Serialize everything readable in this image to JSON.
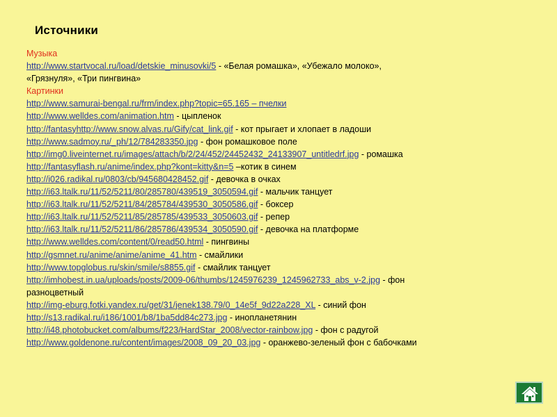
{
  "title": "Источники",
  "sections": {
    "music_label": "Музыка",
    "pictures_label": "Картинки"
  },
  "music": {
    "url": "http://www.startvocal.ru/load/detskie_minusovki/5",
    "desc_line1": " - «Белая ромашка», «Убежало молоко»,",
    "desc_line2": "«Грязнуля», «Три пингвина»"
  },
  "pictures": [
    {
      "url": "http://www.samurai-bengal.ru/frm/index.php?topic=65.165 – пчелки",
      "desc": ""
    },
    {
      "url": "http://www.welldes.com/animation.htm",
      "desc": " - цыпленок"
    },
    {
      "url": "http://fantasyhttp://www.snow.alvas.ru/Gify/cat_link.gif",
      "desc": " - кот прыгает и хлопает в ладоши"
    },
    {
      "url": "http://www.sadmoy.ru/_ph/12/784283350.jpg",
      "desc": " - фон ромашковое поле"
    },
    {
      "url": "http://img0.liveinternet.ru/images/attach/b/2/24/452/24452432_24133907_untitledrf.jpg",
      "desc": " - ромашка"
    },
    {
      "url": "http://fantasyflash.ru/anime/index.php?kont=kitty&n=5",
      "desc": " –котик в синем"
    },
    {
      "url": "http://i026.radikal.ru/0803/cb/945680428452.gif",
      "desc": " - девочка в очках"
    },
    {
      "url": "http://i63.ltalk.ru/11/52/5211/80/285780/439519_3050594.gif",
      "desc": " - мальчик танцует"
    },
    {
      "url": "http://i63.ltalk.ru/11/52/5211/84/285784/439530_3050586.gif",
      "desc": " -  боксер"
    },
    {
      "url": "http://i63.ltalk.ru/11/52/5211/85/285785/439533_3050603.gif",
      "desc": " - репер"
    },
    {
      "url": "http://i63.ltalk.ru/11/52/5211/86/285786/439534_3050590.gif",
      "desc": " - девочка на платформе"
    },
    {
      "url": "http://www.welldes.com/content/0/read50.html",
      "desc": " - пингвины"
    },
    {
      "url": "http://gsmnet.ru/anime/anime/anime_41.htm",
      "desc": " - смайлики"
    },
    {
      "url": "http://www.topglobus.ru/skin/smile/s8855.gif",
      "desc": " - смайлик танцует"
    },
    {
      "url": "http://imhobest.in.ua/uploads/posts/2009-06/thumbs/1245976239_1245962733_abs_v-2.jpg",
      "desc": " -  фон",
      "desc_line2": "разноцветный"
    },
    {
      "url": "http://img-eburg.fotki.yandex.ru/get/31/jenek138.79/0_14e5f_9d22a228_XL",
      "desc": " - синий фон"
    },
    {
      "url": "http://s13.radikal.ru/i186/1001/b8/1ba5dd84c273.jpg",
      "desc": " - инопланетянин"
    },
    {
      "url": "http://i48.photobucket.com/albums/f223/HardStar_2008/vector-rainbow.jpg",
      "desc": " -   фон с  радугой"
    },
    {
      "url": "http://www.goldenone.ru/content/images/2008_09_20_03.jpg",
      "desc": " - оранжево-зеленый  фон с бабочками"
    }
  ],
  "home_button": {
    "icon": "home-icon",
    "bg_color": "#1c7b33"
  },
  "colors": {
    "background": "#f9f598",
    "link": "#2b3a9c",
    "section_label": "#e0301e"
  }
}
